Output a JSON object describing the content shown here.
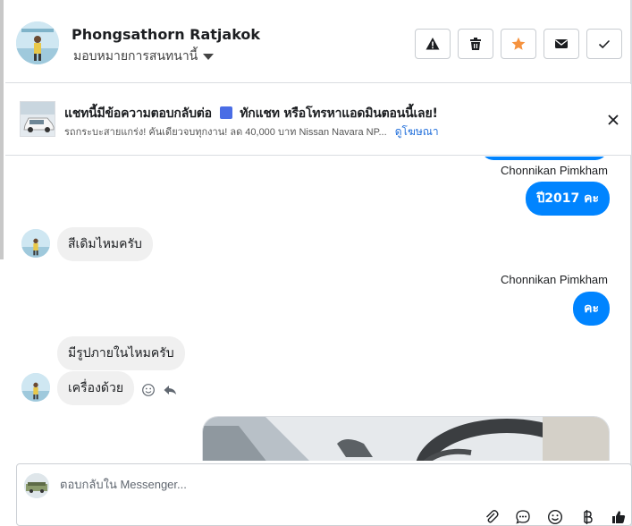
{
  "header": {
    "user_name": "Phongsathorn Ratjakok",
    "assign_label": "มอบหมายการสนทนานี้",
    "actions": [
      {
        "name": "report-button",
        "icon": "warning-icon"
      },
      {
        "name": "delete-button",
        "icon": "trash-icon"
      },
      {
        "name": "star-button",
        "icon": "star-icon"
      },
      {
        "name": "mark-unread-button",
        "icon": "envelope-icon"
      },
      {
        "name": "mark-done-button",
        "icon": "check-icon"
      }
    ]
  },
  "banner": {
    "title_before": "แชทนี้มีข้อความตอบกลับต่อ",
    "title_after": "ทักแชท หรือโทรหาแอดมินตอนนี้เลย!",
    "subtitle": "รถกระบะสายแกร่ง! คันเดียวจบทุกงาน! ลด 40,000 บาท Nissan Navara NP...",
    "link": "ดูโฆษณา"
  },
  "messages": [
    {
      "sender": "Chonnikan Pimkham",
      "direction": "out",
      "text": "ปี2017 คะ"
    },
    {
      "direction": "in",
      "text": "สีเดิมไหมครับ"
    },
    {
      "sender": "Chonnikan Pimkham",
      "direction": "out",
      "text": "คะ"
    },
    {
      "direction": "in",
      "text": "มีรูปภายในไหมครับ"
    },
    {
      "direction": "in",
      "text": "เครื่องด้วย"
    }
  ],
  "composer": {
    "placeholder": "ตอบกลับใน Messenger..."
  },
  "colors": {
    "accent": "#0084ff",
    "star": "#f5923e",
    "link": "#216fdb"
  }
}
